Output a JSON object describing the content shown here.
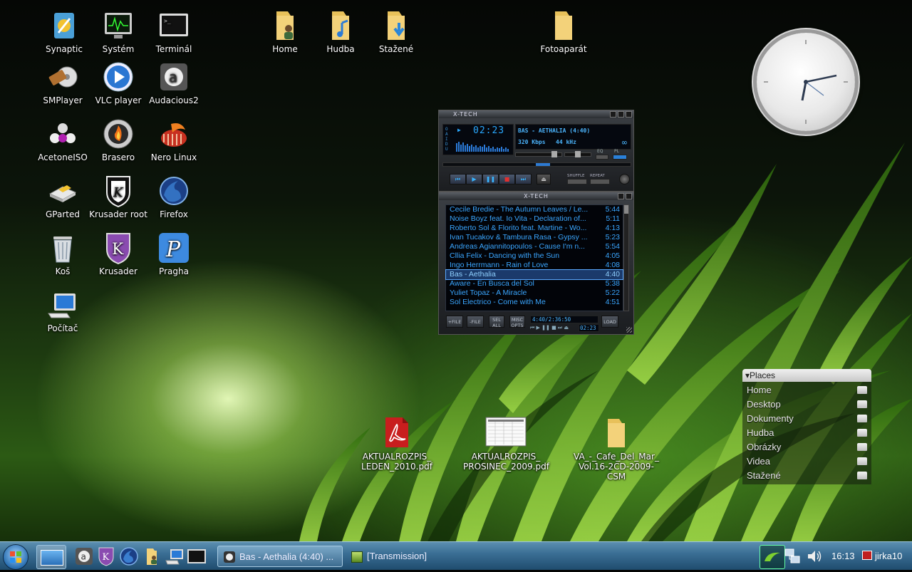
{
  "desktop_icons": [
    {
      "label": "Synaptic"
    },
    {
      "label": "Systém"
    },
    {
      "label": "Terminál"
    },
    {
      "label": "Home"
    },
    {
      "label": "Hudba"
    },
    {
      "label": "Stažené"
    },
    {
      "label": "Fotoaparát"
    },
    {
      "label": "SMPlayer"
    },
    {
      "label": "VLC player"
    },
    {
      "label": "Audacious2"
    },
    {
      "label": "AcetoneISO"
    },
    {
      "label": "Brasero"
    },
    {
      "label": "Nero Linux"
    },
    {
      "label": "GParted"
    },
    {
      "label": "Krusader root"
    },
    {
      "label": "Firefox"
    },
    {
      "label": "Koš"
    },
    {
      "label": "Krusader"
    },
    {
      "label": "Pragha"
    },
    {
      "label": "Počítač"
    }
  ],
  "files": [
    {
      "label": "AKTUALROZPIS_LEDEN_2010.pdf",
      "line1": "AKTUALROZPIS_",
      "line2": "LEDEN_2010.pdf",
      "icon": "pdf-icon"
    },
    {
      "label": "AKTUALROZPIS_PROSINEC_2009.pdf",
      "line1": "AKTUALROZPIS_",
      "line2": "PROSINEC_2009.pdf",
      "icon": "spreadsheet-icon"
    },
    {
      "label": "VA_-_Cafe_Del_Mar_Vol.16-2CD-2009-CSM",
      "line1": "VA_-_Cafe_Del_Mar_",
      "line2": "Vol.16-2CD-2009-CSM",
      "icon": "folder-icon"
    }
  ],
  "player": {
    "title": "X-TECH",
    "time": "02:23",
    "song": "BAS - AETHALIA (4:40)",
    "kbps": "320",
    "kbps_unit": "Kbps",
    "khz": "44",
    "khz_unit": "kHz",
    "eq_label": "EQ",
    "pl_label": "PL",
    "shuffle_label": "SHUFFLE",
    "repeat_label": "REPEAT",
    "vis_label": "O A I D U"
  },
  "playlist": {
    "title": "X-TECH",
    "tracks": [
      {
        "title": "Cecile Bredie - The Autumn Leaves / Le...",
        "duration": "5:44"
      },
      {
        "title": "Noise Boyz feat. Io Vita - Declaration of...",
        "duration": "5:11"
      },
      {
        "title": "Roberto Sol & Florito feat. Martine - Wo...",
        "duration": "4:13"
      },
      {
        "title": "Ivan Tucakov & Tambura Rasa - Gypsy ...",
        "duration": "5:23"
      },
      {
        "title": "Andreas Agiannitopoulos - Cause I'm n...",
        "duration": "5:54"
      },
      {
        "title": "Cllia Felix - Dancing with the Sun",
        "duration": "4:05"
      },
      {
        "title": "Ingo Herrmann - Rain of Love",
        "duration": "4:08"
      },
      {
        "title": "Bas - Aethalia",
        "duration": "4:40"
      },
      {
        "title": "Aware - En Busca del Sol",
        "duration": "5:38"
      },
      {
        "title": "Yuliet Topaz - A Miracle",
        "duration": "5:22"
      },
      {
        "title": "Sol Electrico - Come with Me",
        "duration": "4:51"
      }
    ],
    "selected_index": 7,
    "btn_add_file": "+FILE",
    "btn_remove_file": "-FILE",
    "btn_sel_all_1": "SEL",
    "btn_sel_all_2": "ALL",
    "btn_misc_1": "MISC",
    "btn_misc_2": "OPTS",
    "btn_load": "LOAD",
    "total_time": "4:40/2:36:50",
    "elapsed": "02:23"
  },
  "places": {
    "title": "Places",
    "items": [
      {
        "label": "Home"
      },
      {
        "label": "Desktop"
      },
      {
        "label": "Dokumenty"
      },
      {
        "label": "Hudba"
      },
      {
        "label": "Obrázky"
      },
      {
        "label": "Videa"
      },
      {
        "label": "Stažené"
      }
    ]
  },
  "taskbar": {
    "tasks": [
      {
        "label": "Bas - Aethalia (4:40) ..."
      },
      {
        "label": "[Transmission]"
      }
    ],
    "clock": "16:13",
    "user": "jirka10"
  }
}
